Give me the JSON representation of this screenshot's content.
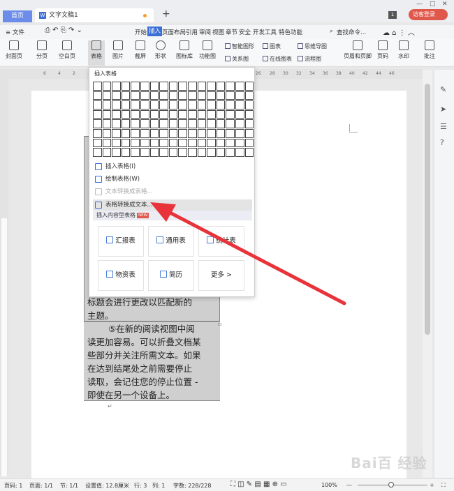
{
  "titlebar": {
    "home_tab": "首页",
    "doc_tab": "文字文稿1",
    "page_badge": "1",
    "login_button": "访客登录"
  },
  "menubar": {
    "file": "≡ 文件",
    "items": [
      "开始",
      "插入",
      "页面布局",
      "引用",
      "审阅",
      "视图",
      "章节",
      "安全",
      "开发工具",
      "特色功能"
    ],
    "active": "插入",
    "search": "查找命令..."
  },
  "ribbon": {
    "cover": "封面页",
    "pagebreak": "分页",
    "blankpage": "空白页",
    "table": "表格",
    "picture": "图片",
    "screenshot": "截屏",
    "shape": "形状",
    "iconlib": "图标库",
    "funcimage": "功能图",
    "smartart": "智能图形",
    "chart": "图表",
    "mindmap": "思维导图",
    "relation": "关系图",
    "online_chart": "在线图表",
    "flowchart": "流程图",
    "header_footer": "页眉和页脚",
    "page_number": "页码",
    "watermark": "水印",
    "comment": "批注"
  },
  "ruler": {
    "ticks_left": [
      "6",
      "4",
      "2"
    ],
    "ticks_right": [
      "26",
      "28",
      "30",
      "32",
      "34",
      "36",
      "38",
      "40",
      "42",
      "44",
      "46"
    ]
  },
  "dropdown": {
    "title": "插入表格",
    "items": {
      "insert_table": "插入表格(I)",
      "draw_table": "绘制表格(W)",
      "text_to_table": "文本转换成表格...",
      "table_to_text": "表格转换成文本..."
    },
    "content_section": "插入内容型表格",
    "new_badge": "NEW",
    "templates": [
      "汇报表",
      "通用表",
      "统计表",
      "物资表",
      "简历",
      "更多 >"
    ]
  },
  "document": {
    "line_a": "标题会进行更改以匹配新的",
    "line_b": "主题。",
    "para_lines": [
      "⑤在新的阅读视图中阅",
      "读更加容易。可以折叠文档某",
      "些部分并关注所需文本。如果",
      "在达到结尾处之前需要停止",
      "读取，会记住您的停止位置 -",
      "即使在另一个设备上。"
    ]
  },
  "statusbar": {
    "page": "页码: 1",
    "pages": "页面: 1/1",
    "section": "节: 1/1",
    "setting": "设置值: 12.8厘米",
    "row": "行: 3",
    "col": "列: 1",
    "words": "字数: 228/228",
    "zoom": "100%"
  },
  "watermark_text": "Bai百 经验",
  "colors": {
    "accent": "#3b6fd6",
    "arrow": "#e8333a",
    "login": "#e0584b"
  }
}
